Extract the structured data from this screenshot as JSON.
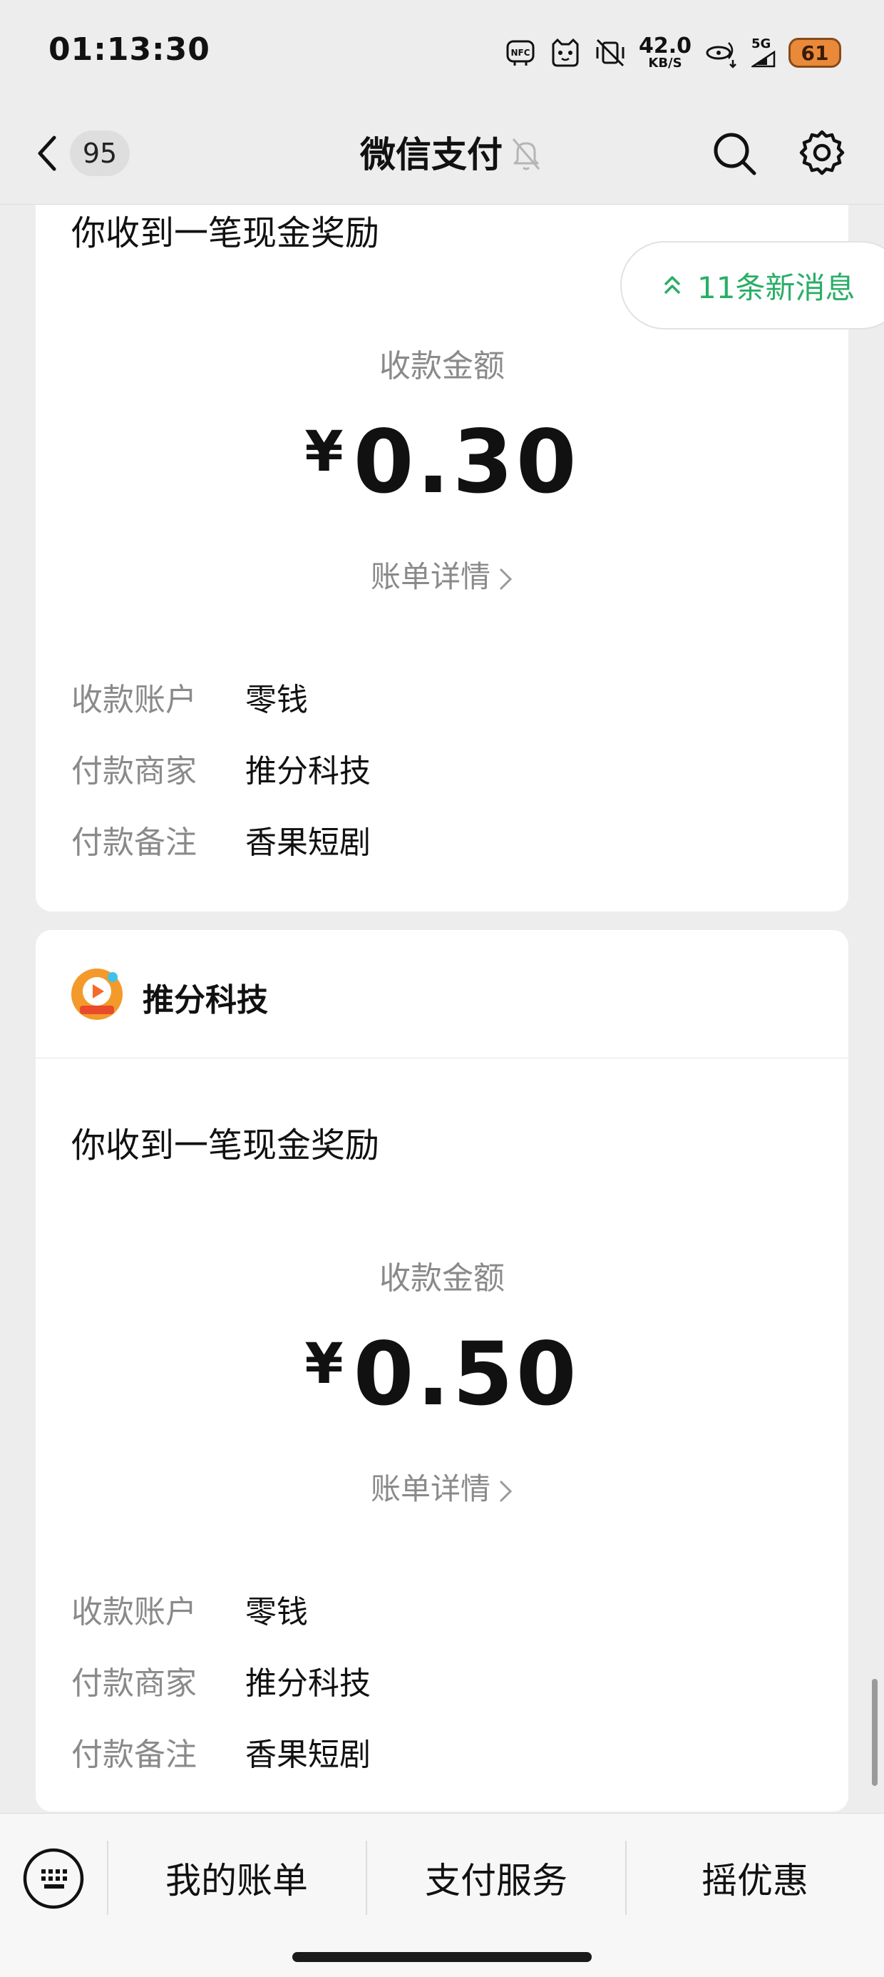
{
  "status_bar": {
    "time": "01:13:30",
    "net_speed": "42.0",
    "net_unit": "KB/S",
    "signal": "5G",
    "battery": "61"
  },
  "nav": {
    "unread_count": "95",
    "title": "微信支付"
  },
  "new_messages": {
    "label": "11条新消息"
  },
  "messages": [
    {
      "headline": "你收到一笔现金奖励",
      "amount_label": "收款金额",
      "currency": "¥",
      "amount": "0.30",
      "bill_detail": "账单详情",
      "rows": [
        {
          "key": "收款账户",
          "value": "零钱"
        },
        {
          "key": "付款商家",
          "value": "推分科技"
        },
        {
          "key": "付款备注",
          "value": "香果短剧"
        }
      ]
    },
    {
      "merchant": "推分科技",
      "headline": "你收到一笔现金奖励",
      "amount_label": "收款金额",
      "currency": "¥",
      "amount": "0.50",
      "bill_detail": "账单详情",
      "rows": [
        {
          "key": "收款账户",
          "value": "零钱"
        },
        {
          "key": "付款商家",
          "value": "推分科技"
        },
        {
          "key": "付款备注",
          "value": "香果短剧"
        }
      ]
    }
  ],
  "bottom_menu": {
    "items": [
      "我的账单",
      "支付服务",
      "摇优惠"
    ]
  },
  "colors": {
    "background": "#ededed",
    "card": "#ffffff",
    "accent_green": "#2aae67",
    "muted_text": "#8a8a8a"
  }
}
